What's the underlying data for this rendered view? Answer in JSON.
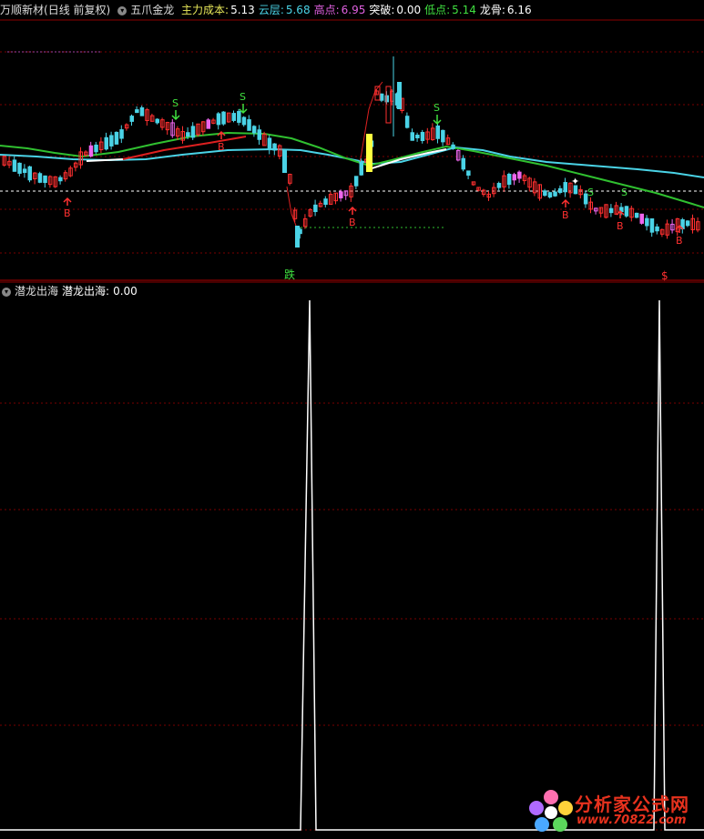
{
  "header": {
    "stock": "万顺新材",
    "period": "(日线 前复权)",
    "indicator": "五爪金龙",
    "items": [
      {
        "label": "主力成本:",
        "value": "5.13",
        "color": "#e8e85a"
      },
      {
        "label": "云层:",
        "value": "5.68",
        "color": "#4ad3e6"
      },
      {
        "label": "高点:",
        "value": "6.95",
        "color": "#e060e0"
      },
      {
        "label": "突破:",
        "value": "0.00",
        "color": "#ffffff"
      },
      {
        "label": "低点:",
        "value": "5.14",
        "color": "#40e040"
      },
      {
        "label": "龙骨:",
        "value": "6.16",
        "color": "#ffffff"
      }
    ]
  },
  "sub": {
    "indicator": "潜龙出海",
    "label": "潜龙出海:",
    "value": "0.00"
  },
  "markers": {
    "buy": "B",
    "sell": "S",
    "drop": "跌",
    "dollar": "$"
  },
  "watermark": {
    "line1": "分析家公式网",
    "line2": "www.70822.com"
  },
  "colors": {
    "up": "#ff3030",
    "down": "#4ad3e6",
    "cloud": "#4ad3e6",
    "keel": "#30c030",
    "cost_line": "#ffffff",
    "grid": "#8b0000"
  }
}
